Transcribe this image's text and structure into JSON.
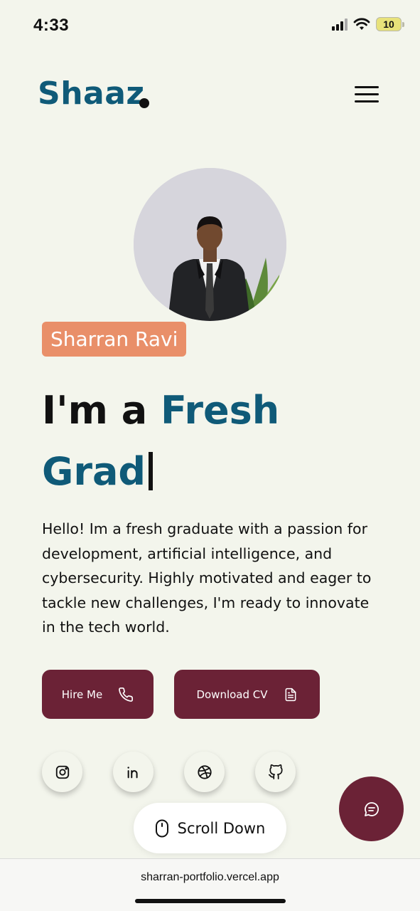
{
  "status_bar": {
    "time": "4:33",
    "battery": "10"
  },
  "header": {
    "logo": "Shaaz",
    "menu_icon": "hamburger-icon"
  },
  "hero": {
    "name_badge": "Sharran Ravi",
    "headline_prefix": "I'm a ",
    "headline_accent_1": "Fresh",
    "headline_accent_2": "Grad",
    "bio": "Hello! Im a fresh graduate with a passion for development, artificial intelligence, and cybersecurity. Highly motivated and eager to tackle new challenges, I'm ready to innovate in the tech world."
  },
  "actions": {
    "hire_label": "Hire Me",
    "hire_icon": "phone-icon",
    "cv_label": "Download CV",
    "cv_icon": "document-icon"
  },
  "socials": [
    "instagram-icon",
    "linkedin-icon",
    "dribbble-icon",
    "github-icon"
  ],
  "scroll": {
    "label": "Scroll Down",
    "icon": "mouse-icon"
  },
  "chat": {
    "icon": "chat-icon"
  },
  "browser": {
    "url": "sharran-portfolio.vercel.app"
  },
  "colors": {
    "background": "#f3f5ec",
    "primary": "#0f5a78",
    "accent": "#6b2236",
    "badge": "#e98f69"
  }
}
